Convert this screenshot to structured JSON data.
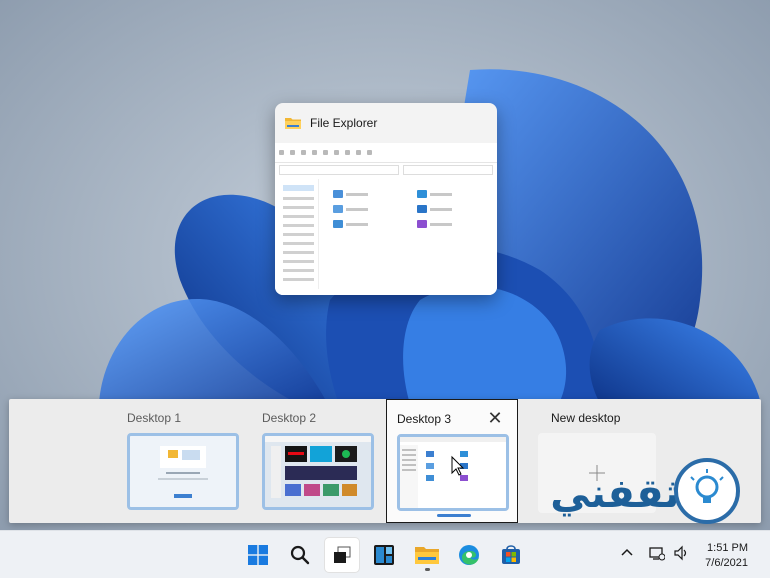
{
  "window_preview": {
    "title": "File Explorer",
    "icon": "folder-icon"
  },
  "task_view": {
    "desktops": [
      {
        "label": "Desktop 1"
      },
      {
        "label": "Desktop 2"
      },
      {
        "label": "Desktop 3"
      }
    ],
    "new_desktop_label": "New desktop",
    "close_glyph": "✕"
  },
  "watermark": {
    "text": "ثقفني"
  },
  "taskbar": {
    "icons": [
      "start-icon",
      "search-icon",
      "task-view-icon",
      "widgets-icon",
      "file-explorer-icon",
      "edge-icon",
      "store-icon"
    ],
    "tray_icons": [
      "chevron-up-icon",
      "network-icon",
      "volume-icon"
    ],
    "time": "1:51 PM",
    "date": "7/6/2021"
  },
  "colors": {
    "accent": "#3c7fd0",
    "wallpaper_bg": "#a9b6c4",
    "bloom": "#1f5fc2"
  }
}
